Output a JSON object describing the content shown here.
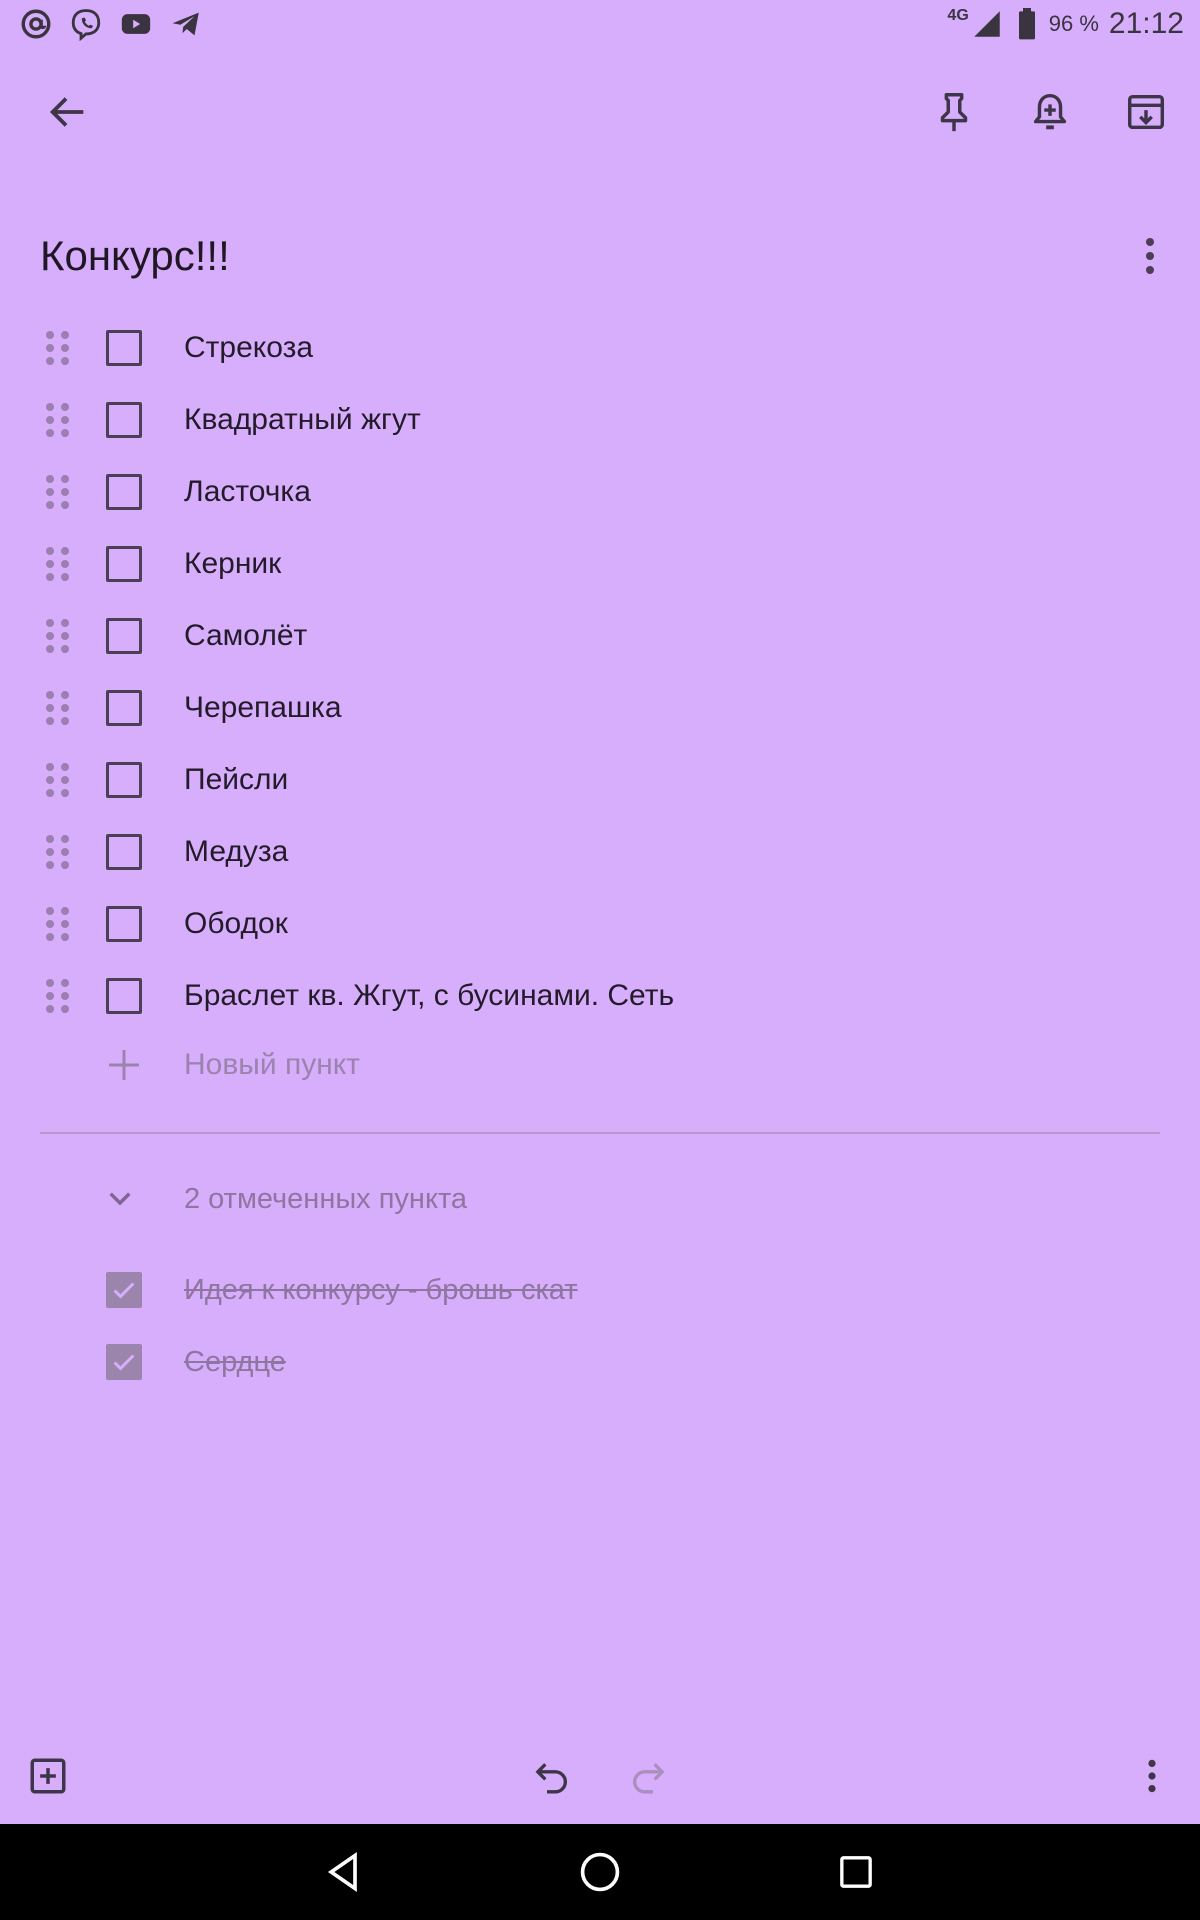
{
  "status_bar": {
    "left_icons": [
      "at-sign-icon",
      "viber-icon",
      "youtube-icon",
      "telegram-icon"
    ],
    "network": "4G",
    "battery_percent": "96 %",
    "time": "21:12"
  },
  "toolbar": {
    "back_icon": "arrow-left-icon",
    "actions": [
      "pin-icon",
      "add-reminder-icon",
      "archive-icon"
    ]
  },
  "note": {
    "title": "Конкурс!!!",
    "items": [
      {
        "label": "Стрекоза",
        "checked": false
      },
      {
        "label": "Квадратный жгут",
        "checked": false
      },
      {
        "label": "Ласточка",
        "checked": false
      },
      {
        "label": "Керник",
        "checked": false
      },
      {
        "label": "Самолёт",
        "checked": false
      },
      {
        "label": "Черепашка",
        "checked": false
      },
      {
        "label": "Пейсли",
        "checked": false
      },
      {
        "label": "Медуза",
        "checked": false
      },
      {
        "label": "Ободок",
        "checked": false
      },
      {
        "label": "Браслет кв. Жгут, с бусинами. Сеть",
        "checked": false
      }
    ],
    "new_item_placeholder": "Новый пункт",
    "checked_header": "2 отмеченных пункта",
    "checked_items": [
      {
        "label": "Идея к конкурсу - брошь скат",
        "checked": true
      },
      {
        "label": "Сердце",
        "checked": true
      }
    ]
  },
  "bottom_bar": {
    "icons": [
      "add-box-icon",
      "undo-icon",
      "redo-icon",
      "more-vert-icon"
    ]
  },
  "nav_bar": {
    "icons": [
      "nav-back-icon",
      "nav-home-icon",
      "nav-recents-icon"
    ]
  },
  "colors": {
    "background": "#d7aefb",
    "nav_bar": "#000000",
    "checkbox_border": "#4a3f55",
    "checked_fill": "#9b85ad",
    "muted_text": "#8e76a0"
  }
}
